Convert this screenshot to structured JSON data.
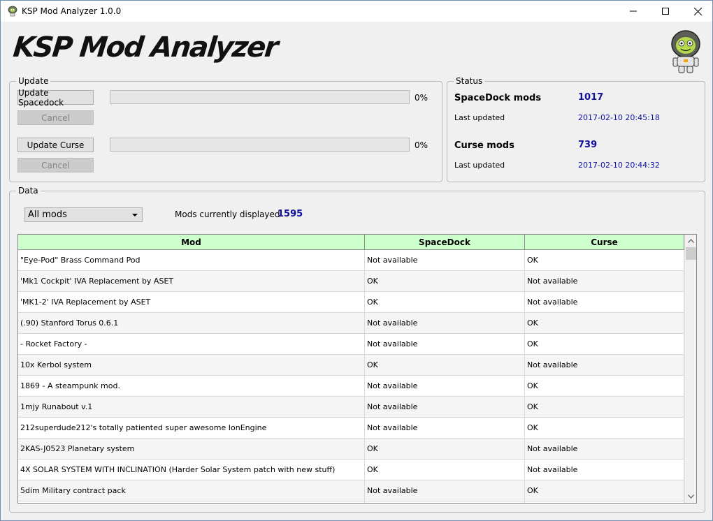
{
  "window": {
    "title": "KSP Mod Analyzer 1.0.0"
  },
  "header": {
    "logo_text": "KSP Mod Analyzer"
  },
  "update": {
    "legend": "Update",
    "spacedock_button": "Update Spacedock",
    "spacedock_cancel": "Cancel",
    "spacedock_progress": "0%",
    "spacedock_progress_value": 0,
    "curse_button": "Update Curse",
    "curse_cancel": "Cancel",
    "curse_progress": "0%",
    "curse_progress_value": 0
  },
  "status": {
    "legend": "Status",
    "spacedock_label": "SpaceDock mods",
    "spacedock_count": "1017",
    "spacedock_updated_label": "Last updated",
    "spacedock_updated": "2017-02-10 20:45:18",
    "curse_label": "Curse mods",
    "curse_count": "739",
    "curse_updated_label": "Last updated",
    "curse_updated": "2017-02-10 20:44:32"
  },
  "data": {
    "legend": "Data",
    "filter_selected": "All mods",
    "displayed_label": "Mods currently displayed",
    "displayed_count": "1595",
    "columns": [
      "Mod",
      "SpaceDock",
      "Curse"
    ],
    "rows": [
      [
        "\"Eye-Pod\" Brass Command Pod",
        "Not available",
        "OK"
      ],
      [
        "'Mk1 Cockpit' IVA Replacement by ASET",
        "OK",
        "Not available"
      ],
      [
        "'MK1-2' IVA Replacement by ASET",
        "OK",
        "Not available"
      ],
      [
        "(.90) Stanford Torus 0.6.1",
        "Not available",
        "OK"
      ],
      [
        "- Rocket Factory  -",
        "Not available",
        "OK"
      ],
      [
        "10x Kerbol system",
        "OK",
        "Not available"
      ],
      [
        "1869 - A steampunk mod.",
        "Not available",
        "OK"
      ],
      [
        "1mjy Runabout v.1",
        "Not available",
        "OK"
      ],
      [
        "212superdude212's totally patiented super awesome IonEngine",
        "Not available",
        "OK"
      ],
      [
        "2KAS-J0523 Planetary system",
        "OK",
        "Not available"
      ],
      [
        "4X SOLAR SYSTEM WITH INCLINATION (Harder Solar System patch with new stuff)",
        "OK",
        "Not available"
      ],
      [
        "5dim Military contract pack",
        "Not available",
        "OK"
      ],
      [
        "",
        "",
        ""
      ]
    ]
  },
  "colors": {
    "header_bg": "#ccffcc",
    "value_text": "#0f0f9f",
    "window_border": "#6d8fb5"
  },
  "icons": {
    "app": "kerbal-icon",
    "minimize": "minimize-icon",
    "maximize": "maximize-icon",
    "close": "close-icon",
    "mascot": "kerbal-astronaut-icon"
  }
}
